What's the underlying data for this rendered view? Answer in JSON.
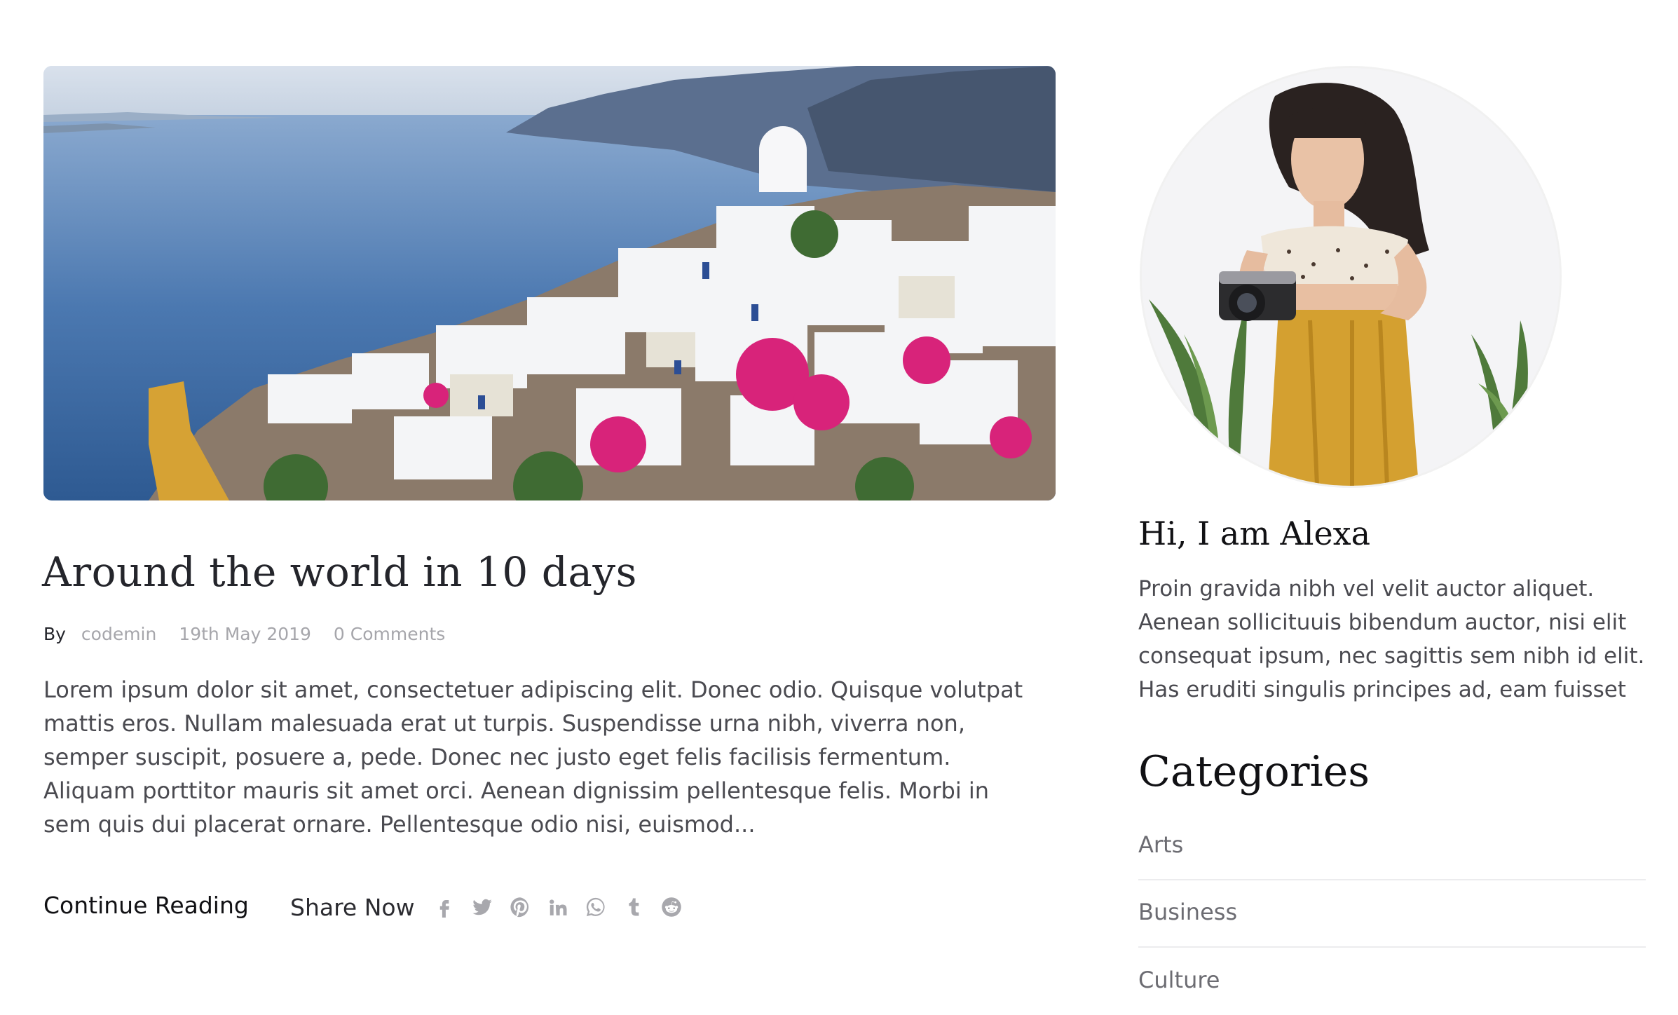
{
  "post": {
    "image_alt": "Santorini village overlooking the sea",
    "title": "Around the world in 10 days",
    "meta": {
      "by_label": "By",
      "author": "codemin",
      "date": "19th May 2019",
      "comments": "0 Comments"
    },
    "excerpt": "Lorem ipsum dolor sit amet, consectetuer adipiscing elit. Donec odio. Quisque volutpat mattis eros. Nullam malesuada erat ut turpis. Suspendisse urna nibh, viverra non, semper suscipit, posuere a, pede. Donec nec justo eget felis facilisis fermentum. Aliquam porttitor mauris sit amet orci. Aenean dignissim pellentesque felis. Morbi in sem quis dui placerat ornare. Pellentesque odio nisi, euismod...",
    "continue_label": "Continue Reading",
    "share": {
      "label": "Share Now",
      "icons": [
        "facebook-icon",
        "twitter-icon",
        "pinterest-icon",
        "linkedin-icon",
        "whatsapp-icon",
        "tumblr-icon",
        "reddit-icon"
      ]
    }
  },
  "sidebar": {
    "author_heading": "Hi, I am Alexa",
    "author_bio": "Proin gravida nibh vel velit auctor aliquet. Aenean sollicituuis bibendum auctor, nisi elit consequat ipsum, nec sagittis sem nibh id elit. Has eruditi singulis principes ad, eam fuisset",
    "categories_heading": "Categories",
    "categories": [
      {
        "label": "Arts"
      },
      {
        "label": "Business"
      },
      {
        "label": "Culture"
      }
    ]
  },
  "colors": {
    "text_dark": "#24252b",
    "text_body": "#4a4a50",
    "text_muted": "#a6a6ab",
    "icon_gray": "#a8a8ad",
    "divider": "#ececee"
  }
}
